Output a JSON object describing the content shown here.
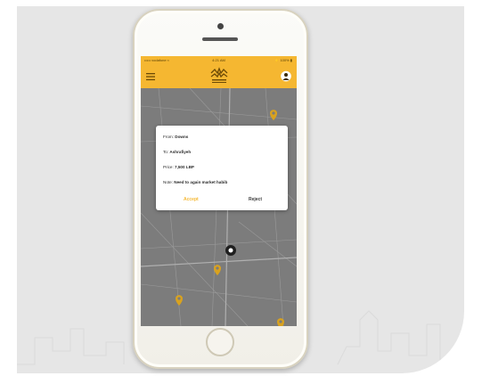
{
  "statusbar": {
    "carrier": "••••• vodafone ≈",
    "time": "4:21 AM",
    "battery": "⚡ 100% ▮"
  },
  "appbar": {
    "menu_icon": "hamburger-menu-icon",
    "logo_icon": "crown-logo-icon",
    "user_icon": "user-avatar-icon"
  },
  "trip_request": {
    "from_label": "From:",
    "from_value": "Downs",
    "to_label": "To:",
    "to_value": "Ashrafiyeh",
    "price_label": "Price:",
    "price_value": "7,500 LBP",
    "note_label": "Note:",
    "note_value": "Need to again market habib",
    "accept_label": "Accept",
    "reject_label": "Reject"
  },
  "colors": {
    "brand_yellow": "#f5b731",
    "map_gray": "#7c7c7c",
    "pin_gold": "#d9a21f"
  }
}
